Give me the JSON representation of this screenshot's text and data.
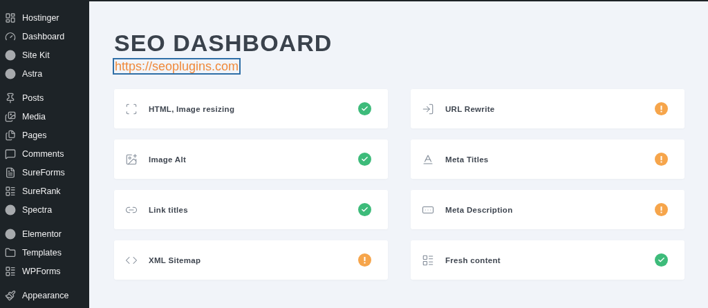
{
  "sidebar": {
    "groups": [
      {
        "items": [
          {
            "label": "Hostinger"
          },
          {
            "label": "Dashboard"
          },
          {
            "label": "Site Kit"
          },
          {
            "label": "Astra"
          }
        ]
      },
      {
        "items": [
          {
            "label": "Posts"
          },
          {
            "label": "Media"
          },
          {
            "label": "Pages"
          },
          {
            "label": "Comments"
          },
          {
            "label": "SureForms"
          },
          {
            "label": "SureRank"
          },
          {
            "label": "Spectra"
          }
        ]
      },
      {
        "items": [
          {
            "label": "Elementor"
          },
          {
            "label": "Templates"
          },
          {
            "label": "WPForms"
          }
        ]
      },
      {
        "items": [
          {
            "label": "Appearance"
          }
        ]
      }
    ]
  },
  "page": {
    "title": "SEO DASHBOARD",
    "link": "https://seoplugins.com"
  },
  "checks": [
    {
      "label": "HTML, Image resizing",
      "passed": true
    },
    {
      "label": "URL Rewrite",
      "passed": false
    },
    {
      "label": "Image Alt",
      "passed": true
    },
    {
      "label": "Meta Titles",
      "passed": false
    },
    {
      "label": "Link titles",
      "passed": true
    },
    {
      "label": "Meta Description",
      "passed": false
    },
    {
      "label": "XML Sitemap",
      "passed": false
    },
    {
      "label": "Fresh content",
      "passed": true
    }
  ]
}
